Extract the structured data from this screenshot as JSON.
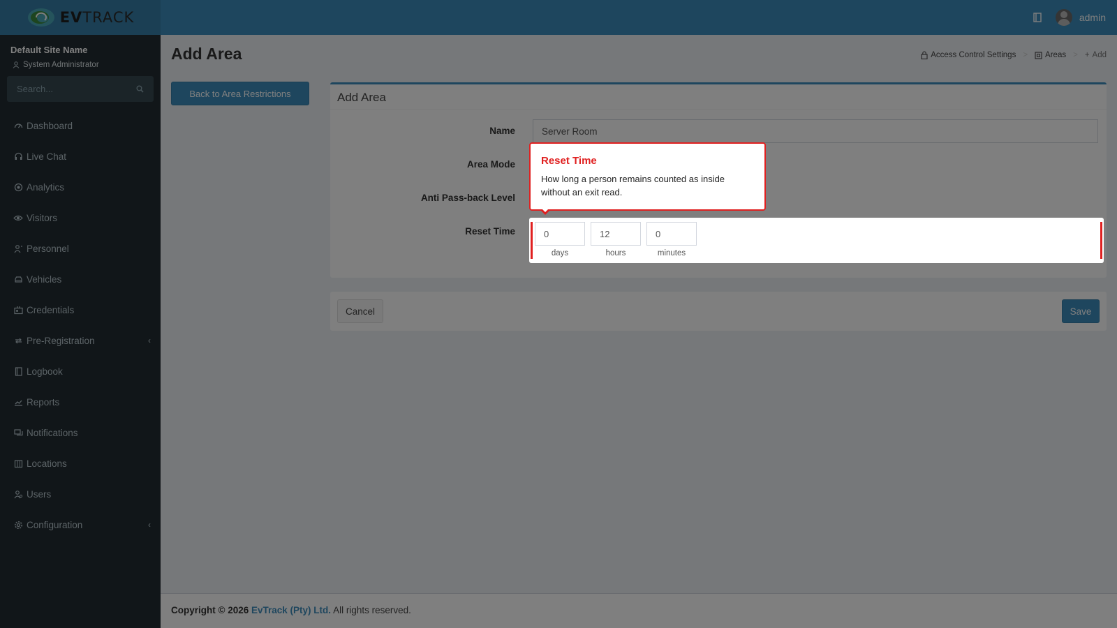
{
  "brand": {
    "logo_text_bold": "EV",
    "logo_text": "TRACK"
  },
  "topbar": {
    "user_name": "admin",
    "icons": [
      "book-icon",
      "user-avatar"
    ]
  },
  "sidebar": {
    "site_name": "Default Site Name",
    "site_role": "System Administrator",
    "search_placeholder": "Search...",
    "items": [
      {
        "label": "Dashboard",
        "icon": "dashboard-icon"
      },
      {
        "label": "Live Chat",
        "icon": "headset-icon"
      },
      {
        "label": "Analytics",
        "icon": "analytics-icon"
      },
      {
        "label": "Visitors",
        "icon": "eye-icon"
      },
      {
        "label": "Personnel",
        "icon": "personnel-icon"
      },
      {
        "label": "Vehicles",
        "icon": "car-icon"
      },
      {
        "label": "Credentials",
        "icon": "id-card-icon"
      },
      {
        "label": "Pre-Registration",
        "icon": "arrows-icon",
        "has_children": true
      },
      {
        "label": "Logbook",
        "icon": "book-icon"
      },
      {
        "label": "Reports",
        "icon": "chart-icon"
      },
      {
        "label": "Notifications",
        "icon": "chat-icon"
      },
      {
        "label": "Locations",
        "icon": "map-icon"
      },
      {
        "label": "Users",
        "icon": "users-icon"
      },
      {
        "label": "Configuration",
        "icon": "gear-icon",
        "has_children": true
      }
    ]
  },
  "page": {
    "title": "Add Area",
    "breadcrumb": [
      {
        "label": "Access Control Settings",
        "icon": "lock-icon"
      },
      {
        "label": "Areas",
        "icon": "area-icon"
      },
      {
        "label": "Add",
        "icon": "plus-icon"
      }
    ],
    "back_button": "Back to Area Restrictions"
  },
  "form": {
    "box_title": "Add Area",
    "name_label": "Name",
    "name_value": "Server Room",
    "area_mode_label": "Area Mode",
    "anti_passback_label": "Anti Pass-back Level",
    "reset_time_label": "Reset Time",
    "reset_time": {
      "days": "0",
      "days_unit": "days",
      "hours": "12",
      "hours_unit": "hours",
      "minutes": "0",
      "minutes_unit": "minutes"
    }
  },
  "actions": {
    "cancel": "Cancel",
    "save": "Save"
  },
  "tooltip": {
    "title": "Reset Time",
    "body": "How long a person remains counted as inside without an exit read."
  },
  "footer": {
    "copyright_prefix": "Copyright © 2026",
    "company": "EvTrack (Pty) Ltd.",
    "suffix": "All rights reserved."
  },
  "colors": {
    "accent": "#3c8dbc",
    "sidebar": "#222d32",
    "highlight": "#e02020"
  }
}
